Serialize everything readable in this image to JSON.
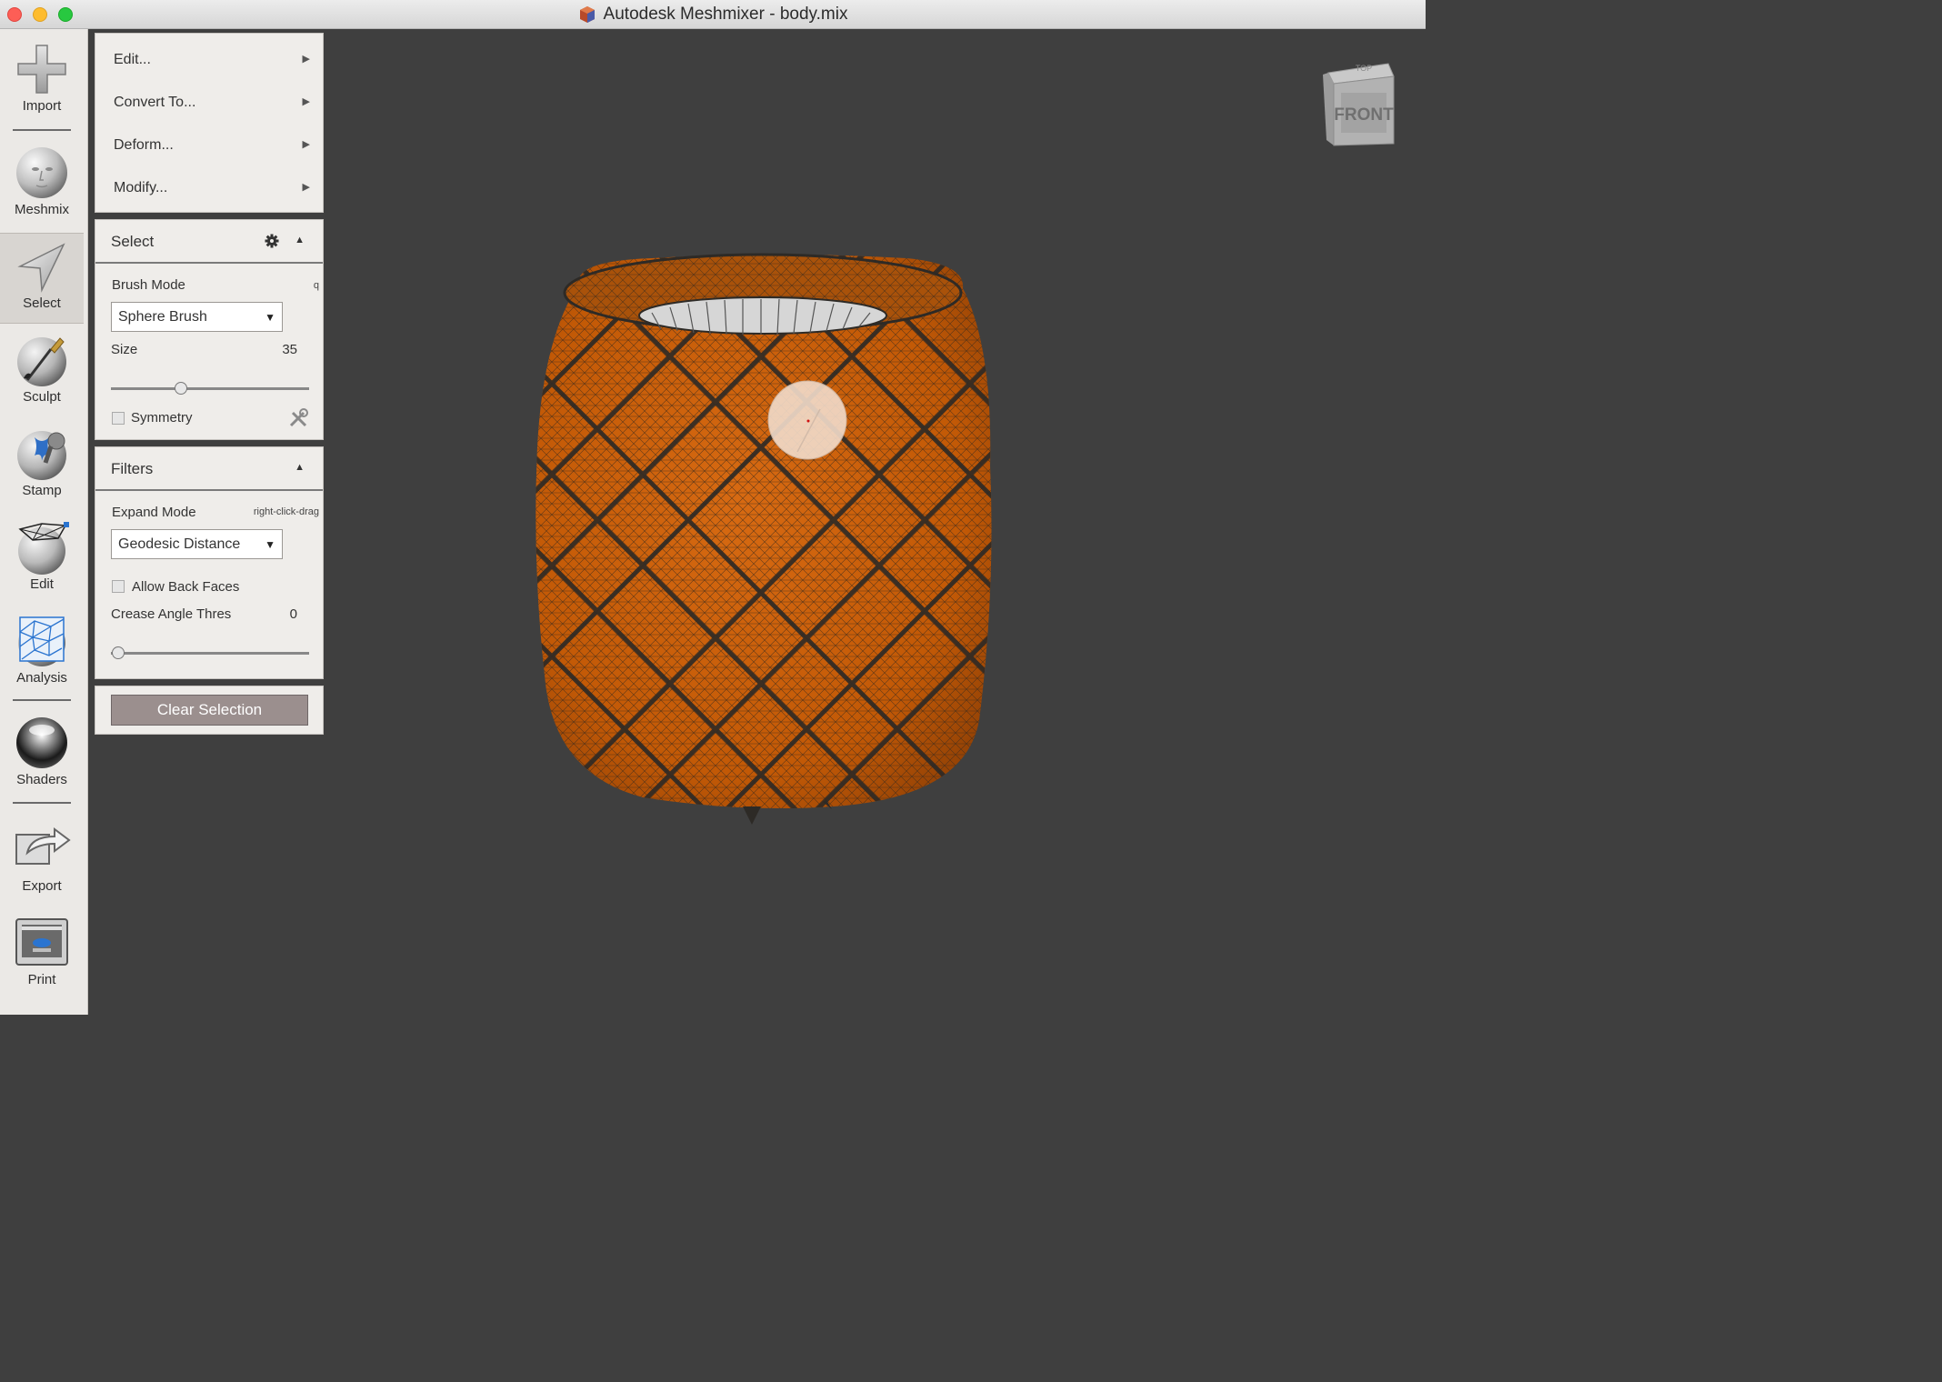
{
  "window": {
    "title": "Autodesk Meshmixer - body.mix"
  },
  "toolbar": {
    "items": [
      {
        "label": "Import",
        "icon": "plus-icon"
      },
      {
        "label": "Meshmix",
        "icon": "face-sphere-icon"
      },
      {
        "label": "Select",
        "icon": "arrow-cursor-icon"
      },
      {
        "label": "Sculpt",
        "icon": "brush-sphere-icon"
      },
      {
        "label": "Stamp",
        "icon": "stamp-icon"
      },
      {
        "label": "Edit",
        "icon": "edit-mesh-icon"
      },
      {
        "label": "Analysis",
        "icon": "analysis-mesh-icon"
      },
      {
        "label": "Shaders",
        "icon": "shader-sphere-icon"
      },
      {
        "label": "Export",
        "icon": "export-icon"
      },
      {
        "label": "Print",
        "icon": "printer-icon"
      }
    ],
    "active": "Select"
  },
  "menu": {
    "items": [
      {
        "label": "Edit..."
      },
      {
        "label": "Convert To..."
      },
      {
        "label": "Deform..."
      },
      {
        "label": "Modify..."
      }
    ]
  },
  "select_panel": {
    "title": "Select",
    "brush_mode_label": "Brush Mode",
    "brush_mode_hotkey": "q",
    "brush_mode_value": "Sphere Brush",
    "size_label": "Size",
    "size_value": "35",
    "size_fraction": 0.35,
    "symmetry_label": "Symmetry",
    "symmetry_checked": false
  },
  "filters_panel": {
    "title": "Filters",
    "expand_mode_label": "Expand Mode",
    "expand_mode_hint": "right-click-drag",
    "expand_mode_value": "Geodesic Distance",
    "allow_back_faces_label": "Allow Back Faces",
    "allow_back_faces_checked": false,
    "crease_label": "Crease Angle Thres",
    "crease_value": "0",
    "crease_fraction": 0.0
  },
  "actions": {
    "clear_selection_label": "Clear Selection"
  },
  "viewcube": {
    "front_label": "FRONT",
    "top_label": "TOP"
  },
  "colors": {
    "mesh_fill": "#c45a06",
    "wire": "#2d2a26",
    "viewport_bg": "#3f3f3f",
    "panel_bg": "#efedea"
  }
}
